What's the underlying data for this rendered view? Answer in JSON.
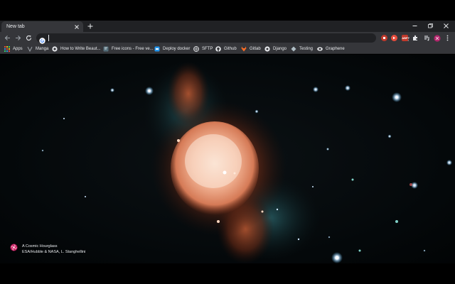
{
  "colors": {
    "tabstrip": "#202124",
    "toolbar": "#35363a",
    "omnibox": "#202124",
    "text": "#e8eaed",
    "extension_red": "#c0392b"
  },
  "tabs": [
    {
      "title": "New tab",
      "active": true,
      "close_icon": "close-icon"
    }
  ],
  "window_controls": [
    "minimize-icon",
    "restore-icon",
    "close-icon"
  ],
  "toolbar": {
    "back_icon": "back-arrow-icon",
    "forward_icon": "forward-arrow-icon",
    "reload_icon": "reload-icon",
    "omnibox_value": "",
    "omnibox_icon": "google-icon",
    "bookmark_star_icon": "star-icon",
    "extensions": [
      {
        "name": "extension-red-1",
        "label": ""
      },
      {
        "name": "extension-red-2",
        "label": ""
      },
      {
        "name": "adblock",
        "label": "ABP"
      },
      {
        "name": "extension-puzzle",
        "label": ""
      },
      {
        "name": "media-control",
        "label": ""
      },
      {
        "name": "profile",
        "label": ""
      },
      {
        "name": "menu",
        "label": ""
      }
    ]
  },
  "bookmarks": [
    {
      "label": "Apps",
      "icon": "apps-grid-icon"
    },
    {
      "label": "Manga",
      "icon": "manga-icon"
    },
    {
      "label": "How to Write Beaut...",
      "icon": "globe-icon"
    },
    {
      "label": "Free icons - Free ve...",
      "icon": "flaticon-icon"
    },
    {
      "label": "Deploy docker",
      "icon": "docker-icon"
    },
    {
      "label": "SFTP",
      "icon": "globe-icon"
    },
    {
      "label": "Github",
      "icon": "github-icon"
    },
    {
      "label": "Gitlab",
      "icon": "gitlab-icon"
    },
    {
      "label": "Django",
      "icon": "globe-icon"
    },
    {
      "label": "Testing",
      "icon": "testing-icon"
    },
    {
      "label": "Graphene",
      "icon": "graphene-icon"
    }
  ],
  "background": {
    "title": "A Cosmic Hourglass",
    "credit": "ESA/Hubble & NASA, L. Stanghellini",
    "icon": "aperture-icon"
  }
}
